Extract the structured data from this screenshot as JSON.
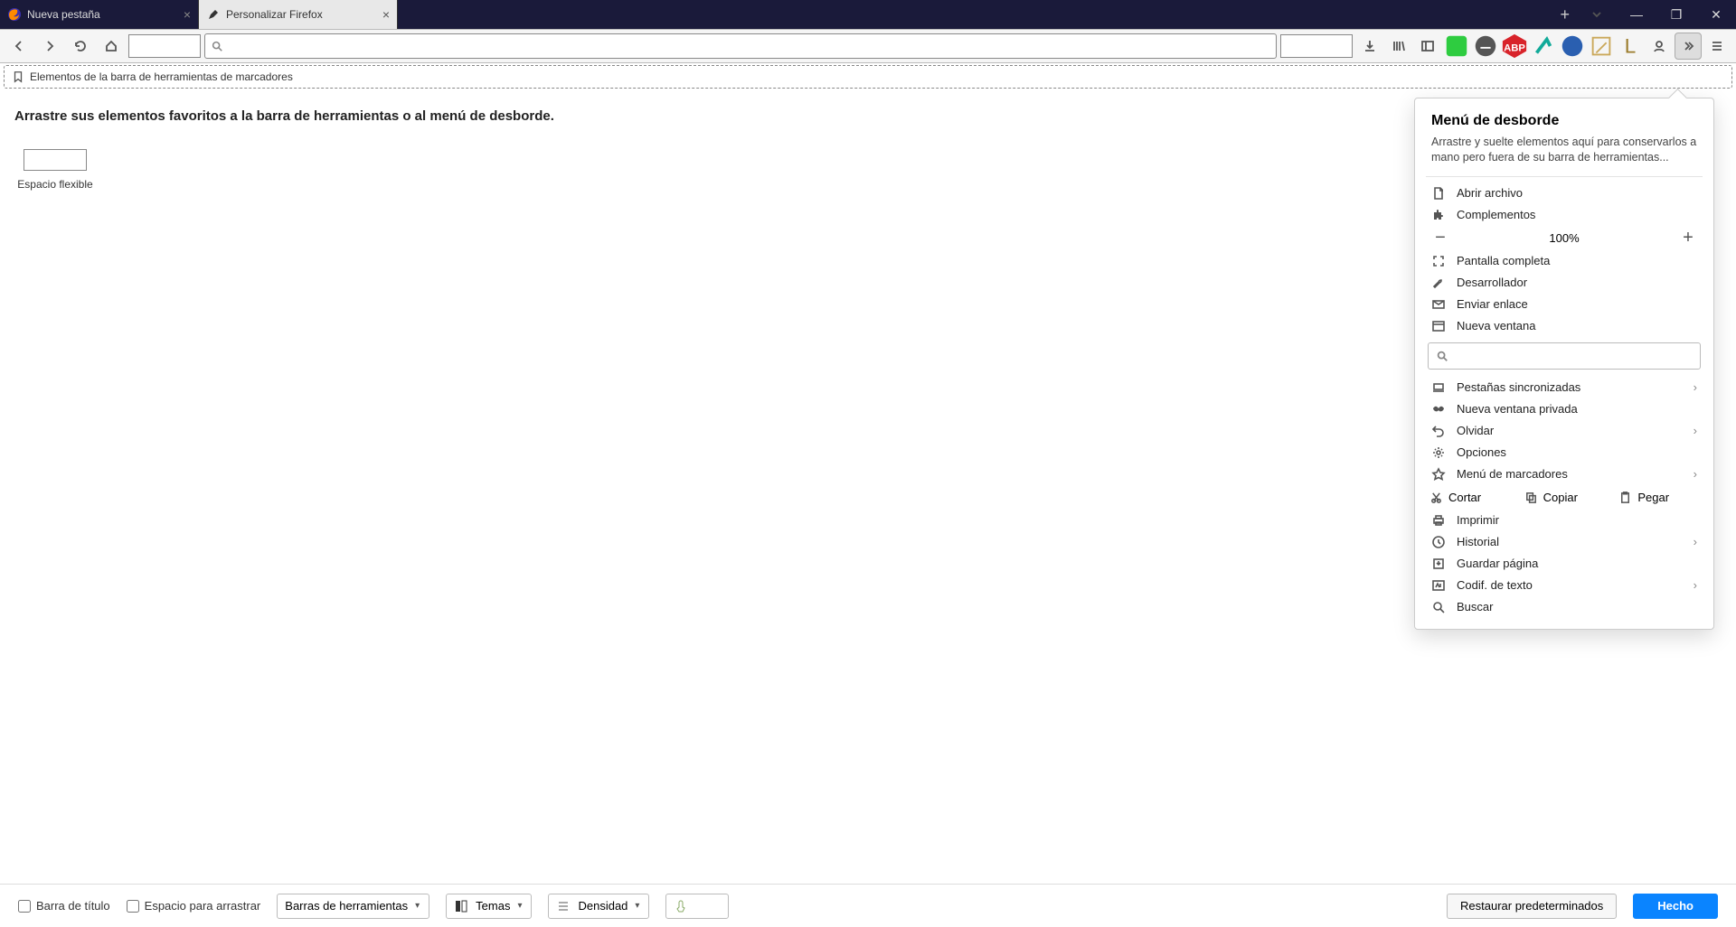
{
  "tabs": {
    "t0": {
      "label": "Nueva pestaña"
    },
    "t1": {
      "label": "Personalizar Firefox"
    }
  },
  "bookmarksBar": {
    "label": "Elementos de la barra de herramientas de marcadores"
  },
  "customize": {
    "instructions": "Arrastre sus elementos favoritos a la barra de herramientas o al menú de desborde.",
    "flexibleSpaceLabel": "Espacio flexible"
  },
  "overflow": {
    "title": "Menú de desborde",
    "desc": "Arrastre y suelte elementos aquí para conservarlos a mano pero fuera de su barra de herramientas...",
    "openFile": "Abrir archivo",
    "addons": "Complementos",
    "zoomPct": "100%",
    "fullscreen": "Pantalla completa",
    "developer": "Desarrollador",
    "sendLink": "Enviar enlace",
    "newWindow": "Nueva ventana",
    "syncedTabs": "Pestañas sincronizadas",
    "privWindow": "Nueva ventana privada",
    "forget": "Olvidar",
    "options": "Opciones",
    "bookmarksMenu": "Menú de marcadores",
    "cut": "Cortar",
    "copy": "Copiar",
    "paste": "Pegar",
    "print": "Imprimir",
    "history": "Historial",
    "savePage": "Guardar página",
    "textEncoding": "Codif. de texto",
    "search": "Buscar"
  },
  "bottom": {
    "titleBar": "Barra de título",
    "dragSpace": "Espacio para arrastrar",
    "toolbars": "Barras de herramientas",
    "themes": "Temas",
    "density": "Densidad",
    "restore": "Restaurar predeterminados",
    "done": "Hecho"
  }
}
